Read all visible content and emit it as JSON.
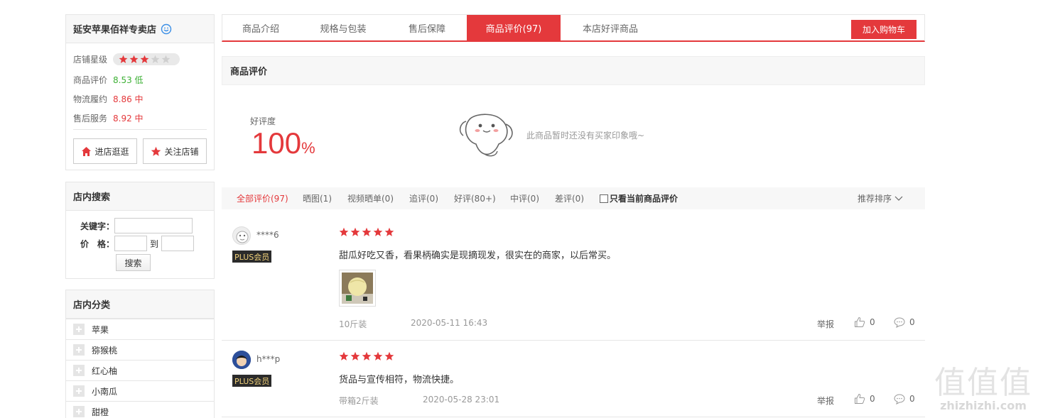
{
  "shop": {
    "name": "延安苹果佰祥专卖店",
    "rating_label": "店铺星级",
    "rating_stars": 3,
    "rating_max": 5,
    "metrics": [
      {
        "label": "商品评价",
        "value": "8.53 低",
        "color": "#3cb034"
      },
      {
        "label": "物流履约",
        "value": "8.86 中",
        "color": "#e4393c"
      },
      {
        "label": "售后服务",
        "value": "8.92 中",
        "color": "#e4393c"
      }
    ],
    "enter_btn": "进店逛逛",
    "follow_btn": "关注店铺"
  },
  "search": {
    "title": "店内搜索",
    "keyword_label": "关键字：",
    "price_label": "价　格：",
    "to_label": "到",
    "button": "搜索"
  },
  "categories": {
    "title": "店内分类",
    "items": [
      "苹果",
      "猕猴桃",
      "红心柚",
      "小南瓜",
      "甜橙"
    ]
  },
  "tabs": {
    "items": [
      "商品介绍",
      "规格与包装",
      "售后保障",
      "商品评价(97)",
      "本店好评商品"
    ],
    "active_index": 3,
    "cart_button": "加入购物车"
  },
  "reviews_section": {
    "title": "商品评价",
    "good_rate_label": "好评度",
    "good_rate_value": "100",
    "good_rate_unit": "%",
    "empty_impression": "此商品暂时还没有买家印象哦~"
  },
  "filters": {
    "items": [
      "全部评价(97)",
      "晒图(1)",
      "视频晒单(0)",
      "追评(0)",
      "好评(80+)",
      "中评(0)",
      "差评(0)"
    ],
    "active_index": 0,
    "only_current": "只看当前商品评价",
    "sort": "推荐排序"
  },
  "reviews": [
    {
      "user": "****6",
      "badge": "PLUS会员",
      "stars": 5,
      "text": "甜瓜好吃又香，看果柄确实是现摘现发，很实在的商家，以后常买。",
      "has_image": true,
      "spec": "10斤装",
      "date": "2020-05-11 16:43",
      "report": "举报",
      "likes": "0",
      "comments": "0"
    },
    {
      "user": "h***p",
      "badge": "PLUS会员",
      "stars": 5,
      "text": "货品与宣传相符，物流快捷。",
      "has_image": false,
      "spec": "带箱2斤装",
      "date": "2020-05-28 23:01",
      "report": "举报",
      "likes": "0",
      "comments": "0"
    }
  ],
  "watermark": {
    "glyphs": "值值值",
    "url": "zhizhizhi.com"
  },
  "colors": {
    "accent": "#e4393c",
    "star_on": "#e4393c",
    "star_off": "#cfcfcf"
  },
  "icons": [
    "chat-icon",
    "star-icon",
    "home-icon",
    "checkbox-icon",
    "chevron-down-icon",
    "thumb-up-icon",
    "comment-icon",
    "mascot-icon",
    "plus-icon"
  ]
}
